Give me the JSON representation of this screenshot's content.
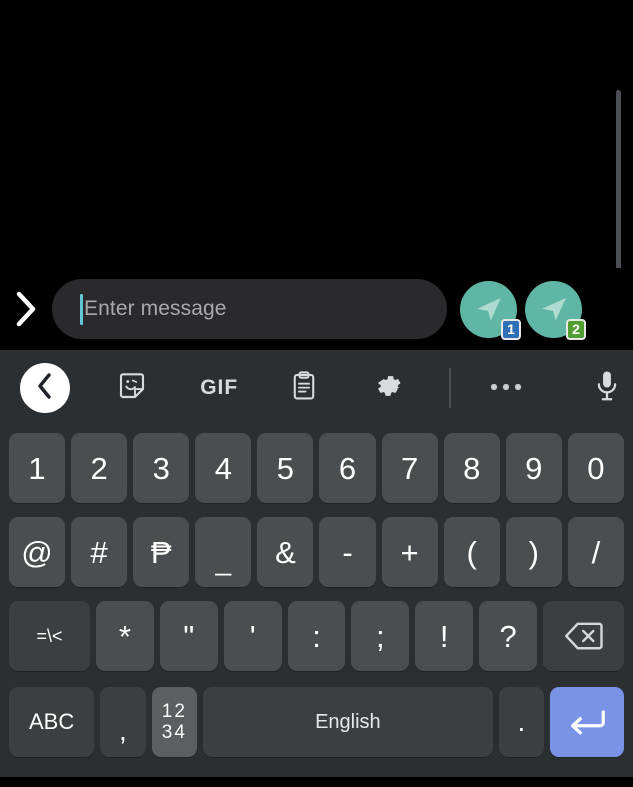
{
  "composer": {
    "expand_icon": "chevron-right-icon",
    "input_placeholder": "Enter message",
    "input_value": "",
    "caret_color": "#63c6d4",
    "send_buttons": [
      {
        "icon": "send-paper-plane-icon",
        "badge": "1",
        "badge_color": "#2f6fb5",
        "button_color": "#5fb6a5"
      },
      {
        "icon": "send-paper-plane-icon",
        "badge": "2",
        "badge_color": "#4f9e2f",
        "button_color": "#5fb6a5"
      }
    ]
  },
  "keyboard": {
    "background_color": "#2b2f31",
    "key_color": "#4b4e50",
    "accent_color": "#7a93e6",
    "toolbar": [
      {
        "name": "back",
        "icon": "chevron-left-icon",
        "label": ""
      },
      {
        "name": "sticker",
        "icon": "sticker-face-icon",
        "label": ""
      },
      {
        "name": "gif",
        "icon": "gif-text-icon",
        "label": "GIF"
      },
      {
        "name": "clipboard",
        "icon": "clipboard-icon",
        "label": ""
      },
      {
        "name": "settings",
        "icon": "gear-icon",
        "label": ""
      },
      {
        "name": "more",
        "icon": "three-dots-icon",
        "label": ""
      },
      {
        "name": "voice-input",
        "icon": "microphone-icon",
        "label": ""
      }
    ],
    "rows": {
      "row1": [
        "1",
        "2",
        "3",
        "4",
        "5",
        "6",
        "7",
        "8",
        "9",
        "0"
      ],
      "row2": [
        "@",
        "#",
        "₱",
        "_",
        "&",
        "-",
        "+",
        "(",
        ")",
        "/"
      ],
      "row3": [
        "=\\<",
        "*",
        "\"",
        "'",
        ":",
        ";",
        "!",
        "?"
      ],
      "row3_backspace": "backspace-icon",
      "row4": {
        "abc": "ABC",
        "comma": ",",
        "numeric": "1 2\n3 4",
        "numeric_line1": "12",
        "numeric_line2": "34",
        "space": "English",
        "period": ".",
        "enter": "enter-return-icon"
      }
    }
  }
}
